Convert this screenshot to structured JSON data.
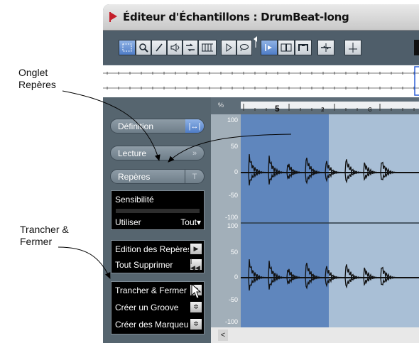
{
  "callouts": {
    "markers_tab": [
      "Onglet",
      "Repères"
    ],
    "slice_close": [
      "Trancher &",
      "Fermer"
    ]
  },
  "window": {
    "title": "Éditeur d'Échantillons : DrumBeat-long",
    "accent": "#c41e2a"
  },
  "toolbar": {
    "buttons": [
      {
        "name": "range-select-icon",
        "active": true
      },
      {
        "name": "zoom-icon",
        "active": false
      },
      {
        "name": "draw-pencil-icon",
        "active": false
      },
      {
        "name": "speaker-play-icon",
        "active": false
      },
      {
        "name": "time-warp-icon",
        "active": false
      },
      {
        "name": "grid-icon",
        "active": false
      },
      {
        "name": "play-icon",
        "active": false
      },
      {
        "name": "loop-icon",
        "active": false
      },
      {
        "name": "show-audio-event-icon",
        "active": true
      },
      {
        "name": "snap-icon",
        "active": false
      },
      {
        "name": "hitpoint-icon",
        "active": false
      },
      {
        "name": "auto-scroll-icon",
        "active": false
      },
      {
        "name": "scissors-icon",
        "active": false
      }
    ]
  },
  "ruler": {
    "header": "%",
    "labels": [
      "5",
      "2",
      "3"
    ]
  },
  "panel": {
    "definition": "Définition",
    "playback": "Lecture",
    "markers": "Repères",
    "sensitivity_label": "Sensibilité",
    "use_label": "Utiliser",
    "use_value": "Tout",
    "actions": [
      {
        "label": "Edition des Repères",
        "icon": "play-triangle-icon"
      },
      {
        "label": "Tout Supprimer",
        "icon": "rewind-icon"
      },
      {
        "label": "Trancher & Fermer",
        "icon": "gear-icon"
      },
      {
        "label": "Créer un Groove",
        "icon": "gear-icon"
      },
      {
        "label": "Créer des Marqueurs",
        "icon": "gear-icon"
      }
    ]
  },
  "yaxis": {
    "ch1": [
      "100",
      "50",
      "0",
      "-50",
      "-100"
    ],
    "ch2": [
      "100",
      "50",
      "0",
      "-50",
      "-100"
    ]
  },
  "colors": {
    "selection": "#5f86bd",
    "waveform_bg": "#a9bfd6",
    "active_button": "#4f7dc7"
  }
}
